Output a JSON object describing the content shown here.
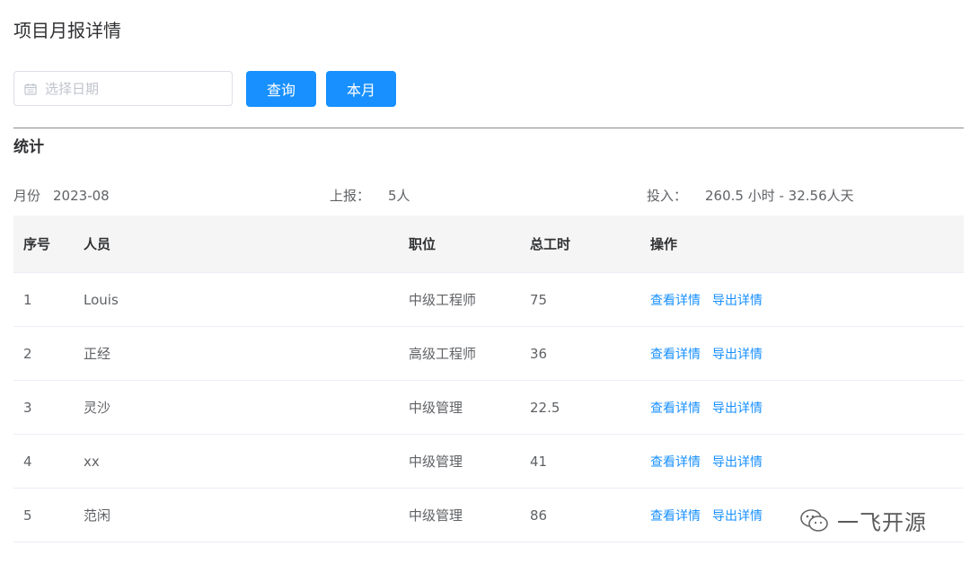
{
  "page_title": "项目月报详情",
  "filter": {
    "date_placeholder": "选择日期",
    "query_label": "查询",
    "month_label": "本月"
  },
  "stats": {
    "section_title": "统计",
    "month_label": "月份",
    "month_value": "2023-08",
    "report_label": "上报：",
    "report_value": "5人",
    "invest_label": "投入：",
    "invest_value": "260.5 小时 - 32.56人天"
  },
  "table": {
    "columns": [
      "序号",
      "人员",
      "职位",
      "总工时",
      "操作"
    ],
    "rows": [
      {
        "idx": "1",
        "name": "Louis",
        "position": "中级工程师",
        "hours": "75",
        "view": "查看详情",
        "export": "导出详情"
      },
      {
        "idx": "2",
        "name": "正经",
        "position": "高级工程师",
        "hours": "36",
        "view": "查看详情",
        "export": "导出详情"
      },
      {
        "idx": "3",
        "name": "灵沙",
        "position": "中级管理",
        "hours": "22.5",
        "view": "查看详情",
        "export": "导出详情"
      },
      {
        "idx": "4",
        "name": "xx",
        "position": "中级管理",
        "hours": "41",
        "view": "查看详情",
        "export": "导出详情"
      },
      {
        "idx": "5",
        "name": "范闲",
        "position": "中级管理",
        "hours": "86",
        "view": "查看详情",
        "export": "导出详情"
      }
    ]
  },
  "watermark": {
    "text": "一飞开源",
    "icon": "wechat-icon"
  },
  "colors": {
    "primary": "#1890ff",
    "header_bg": "#f5f5f5",
    "text": "#606266"
  }
}
